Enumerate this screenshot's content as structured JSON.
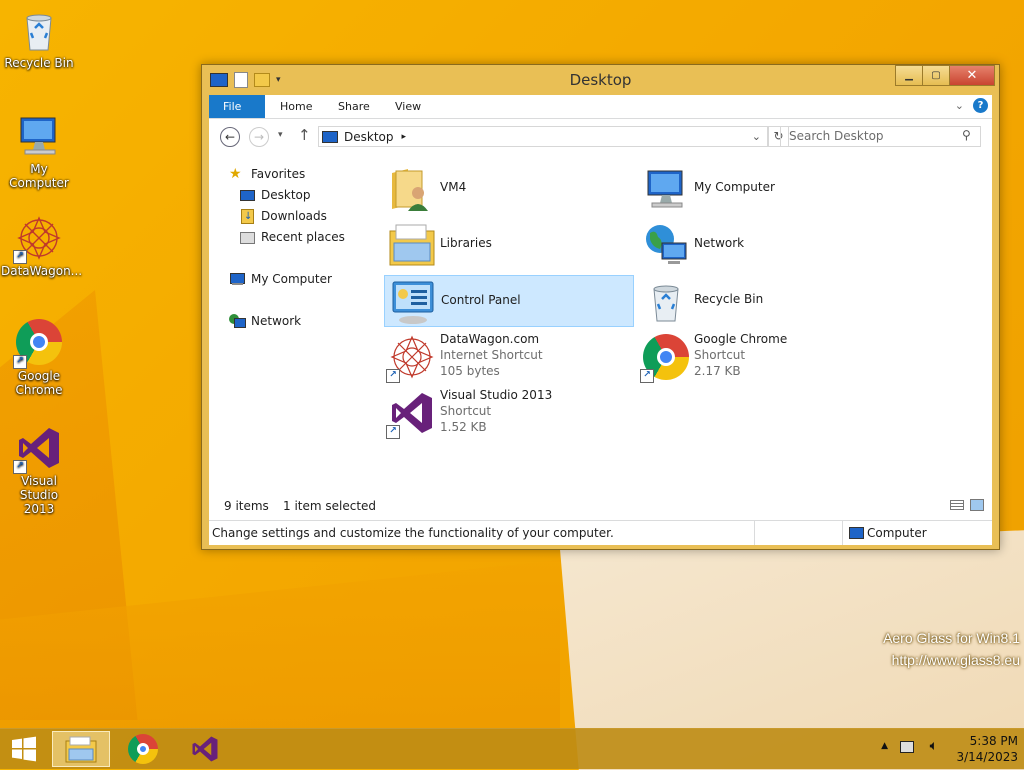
{
  "desktop": {
    "icons": [
      {
        "label": "Recycle Bin"
      },
      {
        "label": "My Computer"
      },
      {
        "label": "DataWagon..."
      },
      {
        "label": "Google Chrome"
      },
      {
        "label": "Visual Studio 2013"
      }
    ],
    "watermark": {
      "line1": "Aero Glass for Win8.1",
      "line2": "http://www.glass8.eu"
    }
  },
  "window": {
    "title": "Desktop",
    "ribbon_tabs": {
      "file": "File",
      "home": "Home",
      "share": "Share",
      "view": "View"
    },
    "address": {
      "location": "Desktop",
      "search_placeholder": "Search Desktop"
    },
    "nav": {
      "favorites": "Favorites",
      "desktop": "Desktop",
      "downloads": "Downloads",
      "recent": "Recent places",
      "computer": "My Computer",
      "network": "Network"
    },
    "items": [
      {
        "name": "VM4"
      },
      {
        "name": "My Computer"
      },
      {
        "name": "Libraries"
      },
      {
        "name": "Network"
      },
      {
        "name": "Control Panel"
      },
      {
        "name": "Recycle Bin"
      },
      {
        "name": "DataWagon.com",
        "type": "Internet Shortcut",
        "size": "105 bytes"
      },
      {
        "name": "Google Chrome",
        "type": "Shortcut",
        "size": "2.17 KB"
      },
      {
        "name": "Visual Studio 2013",
        "type": "Shortcut",
        "size": "1.52 KB"
      }
    ],
    "status": {
      "count": "9 items",
      "selected": "1 item selected"
    },
    "infobar": {
      "description": "Change settings and customize the functionality of your computer.",
      "location": "Computer"
    }
  },
  "taskbar": {
    "time": "5:38 PM",
    "date": "3/14/2023"
  }
}
